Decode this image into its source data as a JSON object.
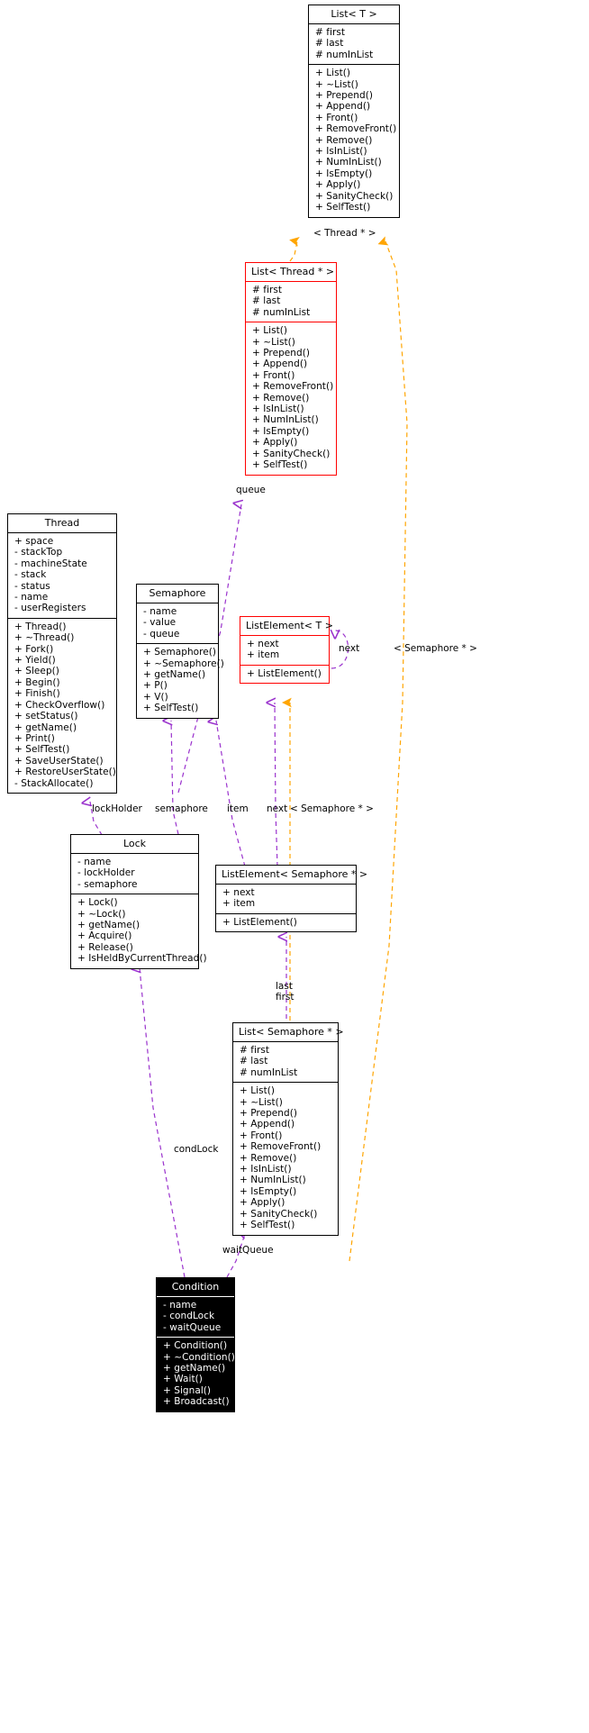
{
  "diagram": {
    "kind": "uml-class-diagram",
    "title_visible": false,
    "colors": {
      "node_border": "#000000",
      "template_border": "#ff0000",
      "selected_fill": "#000000",
      "selected_text": "#ffffff",
      "inheritance_edge": "#ffa500",
      "usage_edge": "#9a32cd",
      "background": "#ffffff"
    }
  },
  "nodes": {
    "list_t": {
      "name": "List< T >",
      "selected": false,
      "template": false,
      "attributes": [
        "# first",
        "# last",
        "# numInList"
      ],
      "methods": [
        "+ List()",
        "+ ~List()",
        "+ Prepend()",
        "+ Append()",
        "+ Front()",
        "+ RemoveFront()",
        "+ Remove()",
        "+ IsInList()",
        "+ NumInList()",
        "+ IsEmpty()",
        "+ Apply()",
        "+ SanityCheck()",
        "+ SelfTest()"
      ]
    },
    "list_thread": {
      "name": "List< Thread * >",
      "selected": false,
      "template": true,
      "attributes": [
        "# first",
        "# last",
        "# numInList"
      ],
      "methods": [
        "+ List()",
        "+ ~List()",
        "+ Prepend()",
        "+ Append()",
        "+ Front()",
        "+ RemoveFront()",
        "+ Remove()",
        "+ IsInList()",
        "+ NumInList()",
        "+ IsEmpty()",
        "+ Apply()",
        "+ SanityCheck()",
        "+ SelfTest()"
      ]
    },
    "thread": {
      "name": "Thread",
      "selected": false,
      "template": false,
      "attributes": [
        "+ space",
        "- stackTop",
        "- machineState",
        "- stack",
        "- status",
        "- name",
        "- userRegisters"
      ],
      "methods": [
        "+ Thread()",
        "+ ~Thread()",
        "+ Fork()",
        "+ Yield()",
        "+ Sleep()",
        "+ Begin()",
        "+ Finish()",
        "+ CheckOverflow()",
        "+ setStatus()",
        "+ getName()",
        "+ Print()",
        "+ SelfTest()",
        "+ SaveUserState()",
        "+ RestoreUserState()",
        "- StackAllocate()"
      ]
    },
    "semaphore": {
      "name": "Semaphore",
      "selected": false,
      "template": false,
      "attributes": [
        "- name",
        "- value",
        "- queue"
      ],
      "methods": [
        "+ Semaphore()",
        "+ ~Semaphore()",
        "+ getName()",
        "+ P()",
        "+ V()",
        "+ SelfTest()"
      ]
    },
    "listelement_t": {
      "name": "ListElement< T >",
      "selected": false,
      "template": true,
      "attributes": [
        "+ next",
        "+ item"
      ],
      "methods": [
        "+ ListElement()"
      ]
    },
    "lock": {
      "name": "Lock",
      "selected": false,
      "template": false,
      "attributes": [
        "- name",
        "- lockHolder",
        "- semaphore"
      ],
      "methods": [
        "+ Lock()",
        "+ ~Lock()",
        "+ getName()",
        "+ Acquire()",
        "+ Release()",
        "+ IsHeldByCurrentThread()"
      ]
    },
    "listelement_sem": {
      "name": "ListElement< Semaphore * >",
      "selected": false,
      "template": false,
      "attributes": [
        "+ next",
        "+ item"
      ],
      "methods": [
        "+ ListElement()"
      ]
    },
    "list_sem": {
      "name": "List< Semaphore * >",
      "selected": false,
      "template": false,
      "attributes": [
        "# first",
        "# last",
        "# numInList"
      ],
      "methods": [
        "+ List()",
        "+ ~List()",
        "+ Prepend()",
        "+ Append()",
        "+ Front()",
        "+ RemoveFront()",
        "+ Remove()",
        "+ IsInList()",
        "+ NumInList()",
        "+ IsEmpty()",
        "+ Apply()",
        "+ SanityCheck()",
        "+ SelfTest()"
      ]
    },
    "condition": {
      "name": "Condition",
      "selected": true,
      "template": false,
      "attributes": [
        "- name",
        "- condLock",
        "- waitQueue"
      ],
      "methods": [
        "+ Condition()",
        "+ ~Condition()",
        "+ getName()",
        "+ Wait()",
        "+ Signal()",
        "+ Broadcast()"
      ]
    }
  },
  "edge_labels": {
    "thread_ptr": "< Thread * >",
    "semaphore_ptr_right": "< Semaphore * >",
    "semaphore_ptr_mid": "< Semaphore * >",
    "queue": "queue",
    "next_top": "next",
    "lock_holder": "lockHolder",
    "semaphore": "semaphore",
    "item": "item",
    "next_mid": "next",
    "last": "last",
    "first": "first",
    "cond_lock": "condLock",
    "wait_queue": "waitQueue"
  }
}
